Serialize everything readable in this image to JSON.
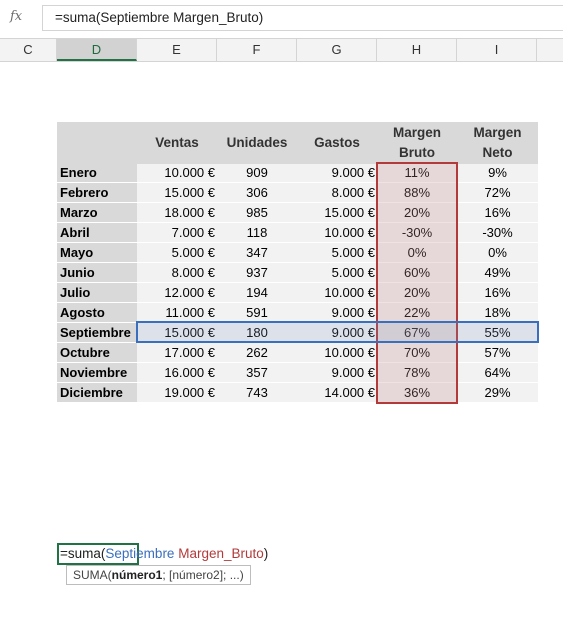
{
  "formula_bar": {
    "fx_label": "fx",
    "formula": "=suma(Septiembre Margen_Bruto)"
  },
  "columns": [
    "C",
    "D",
    "E",
    "F",
    "G",
    "H",
    "I"
  ],
  "selected_column": "D",
  "table": {
    "headers": {
      "ventas": "Ventas",
      "unidades": "Unidades",
      "gastos": "Gastos",
      "margen_bruto_1": "Margen",
      "margen_bruto_2": "Bruto",
      "margen_neto_1": "Margen",
      "margen_neto_2": "Neto"
    },
    "rows": [
      {
        "month": "Enero",
        "ventas": "10.000 €",
        "unidades": "909",
        "gastos": "9.000 €",
        "mb": "11%",
        "mn": "9%"
      },
      {
        "month": "Febrero",
        "ventas": "15.000 €",
        "unidades": "306",
        "gastos": "8.000 €",
        "mb": "88%",
        "mn": "72%"
      },
      {
        "month": "Marzo",
        "ventas": "18.000 €",
        "unidades": "985",
        "gastos": "15.000 €",
        "mb": "20%",
        "mn": "16%"
      },
      {
        "month": "Abril",
        "ventas": "7.000 €",
        "unidades": "118",
        "gastos": "10.000 €",
        "mb": "-30%",
        "mn": "-30%"
      },
      {
        "month": "Mayo",
        "ventas": "5.000 €",
        "unidades": "347",
        "gastos": "5.000 €",
        "mb": "0%",
        "mn": "0%"
      },
      {
        "month": "Junio",
        "ventas": "8.000 €",
        "unidades": "937",
        "gastos": "5.000 €",
        "mb": "60%",
        "mn": "49%"
      },
      {
        "month": "Julio",
        "ventas": "12.000 €",
        "unidades": "194",
        "gastos": "10.000 €",
        "mb": "20%",
        "mn": "16%"
      },
      {
        "month": "Agosto",
        "ventas": "11.000 €",
        "unidades": "591",
        "gastos": "9.000 €",
        "mb": "22%",
        "mn": "18%"
      },
      {
        "month": "Septiembre",
        "ventas": "15.000 €",
        "unidades": "180",
        "gastos": "9.000 €",
        "mb": "67%",
        "mn": "55%"
      },
      {
        "month": "Octubre",
        "ventas": "17.000 €",
        "unidades": "262",
        "gastos": "10.000 €",
        "mb": "70%",
        "mn": "57%"
      },
      {
        "month": "Noviembre",
        "ventas": "16.000 €",
        "unidades": "357",
        "gastos": "9.000 €",
        "mb": "78%",
        "mn": "64%"
      },
      {
        "month": "Diciembre",
        "ventas": "19.000 €",
        "unidades": "743",
        "gastos": "14.000 €",
        "mb": "36%",
        "mn": "29%"
      }
    ]
  },
  "edit_cell": {
    "prefix": "=suma(",
    "ref1": "Septiembre",
    "space": " ",
    "ref2": "Margen_Bruto",
    "suffix": ")"
  },
  "tooltip": {
    "fn": "SUMA(",
    "arg1": "número1",
    "rest": "; [número2]; ...)"
  },
  "colors": {
    "header_band": "#d9d9d9",
    "body_fill": "#f2f2f2",
    "margen_bruto_border": "#b23a3a",
    "row_border": "#3a6fbd",
    "excel_green": "#217346"
  }
}
